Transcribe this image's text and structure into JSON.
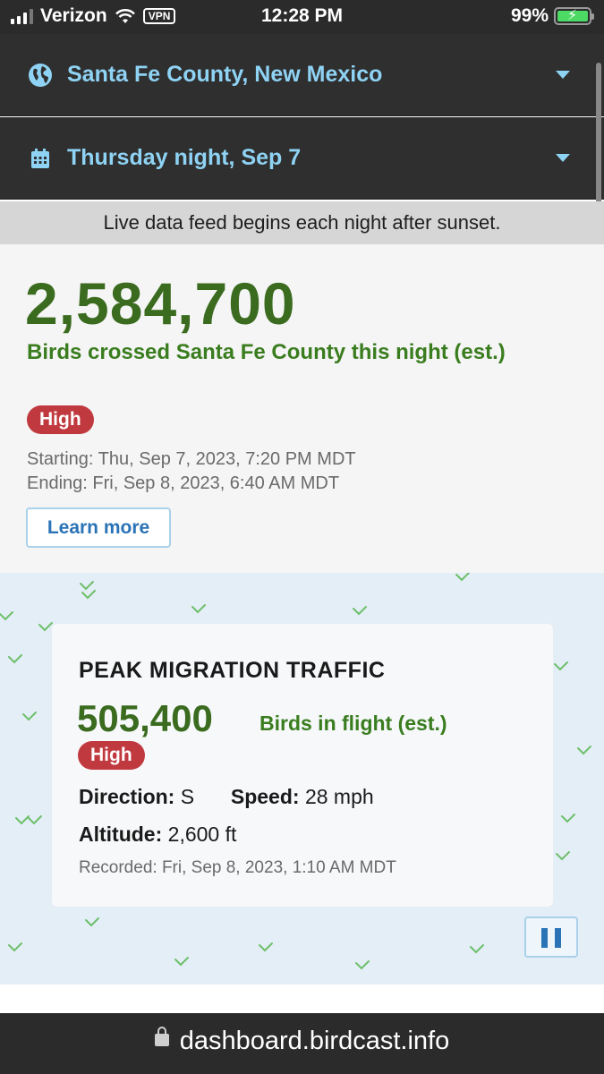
{
  "status_bar": {
    "carrier": "Verizon",
    "vpn": "VPN",
    "time": "12:28 PM",
    "battery": "99%"
  },
  "location_selector": {
    "label": "Santa Fe County, New Mexico",
    "icon": "globe-icon"
  },
  "date_selector": {
    "label": "Thursday night, Sep 7",
    "icon": "calendar-icon"
  },
  "info_bar": {
    "text": "Live data feed begins each night after sunset."
  },
  "summary": {
    "count": "2,584,700",
    "description": "Birds crossed Santa Fe County this night (est.)",
    "level": "High",
    "starting": "Starting: Thu, Sep 7, 2023, 7:20 PM MDT",
    "ending": "Ending: Fri, Sep 8, 2023, 6:40 AM MDT",
    "learn_more": "Learn more"
  },
  "peak": {
    "title": "PEAK MIGRATION TRAFFIC",
    "count": "505,400",
    "unit": "Birds in flight (est.)",
    "level": "High",
    "direction_label": "Direction:",
    "direction_value": "S",
    "speed_label": "Speed:",
    "speed_value": "28 mph",
    "altitude_label": "Altitude:",
    "altitude_value": "2,600 ft",
    "recorded": "Recorded: Fri, Sep 8, 2023, 1:10 AM MDT"
  },
  "url_bar": {
    "url": "dashboard.birdcast.info"
  },
  "colors": {
    "accent_blue": "#8fd3f4",
    "count_green": "#3a6b1f",
    "badge_red": "#c0393f",
    "link_blue": "#2a73b6"
  }
}
